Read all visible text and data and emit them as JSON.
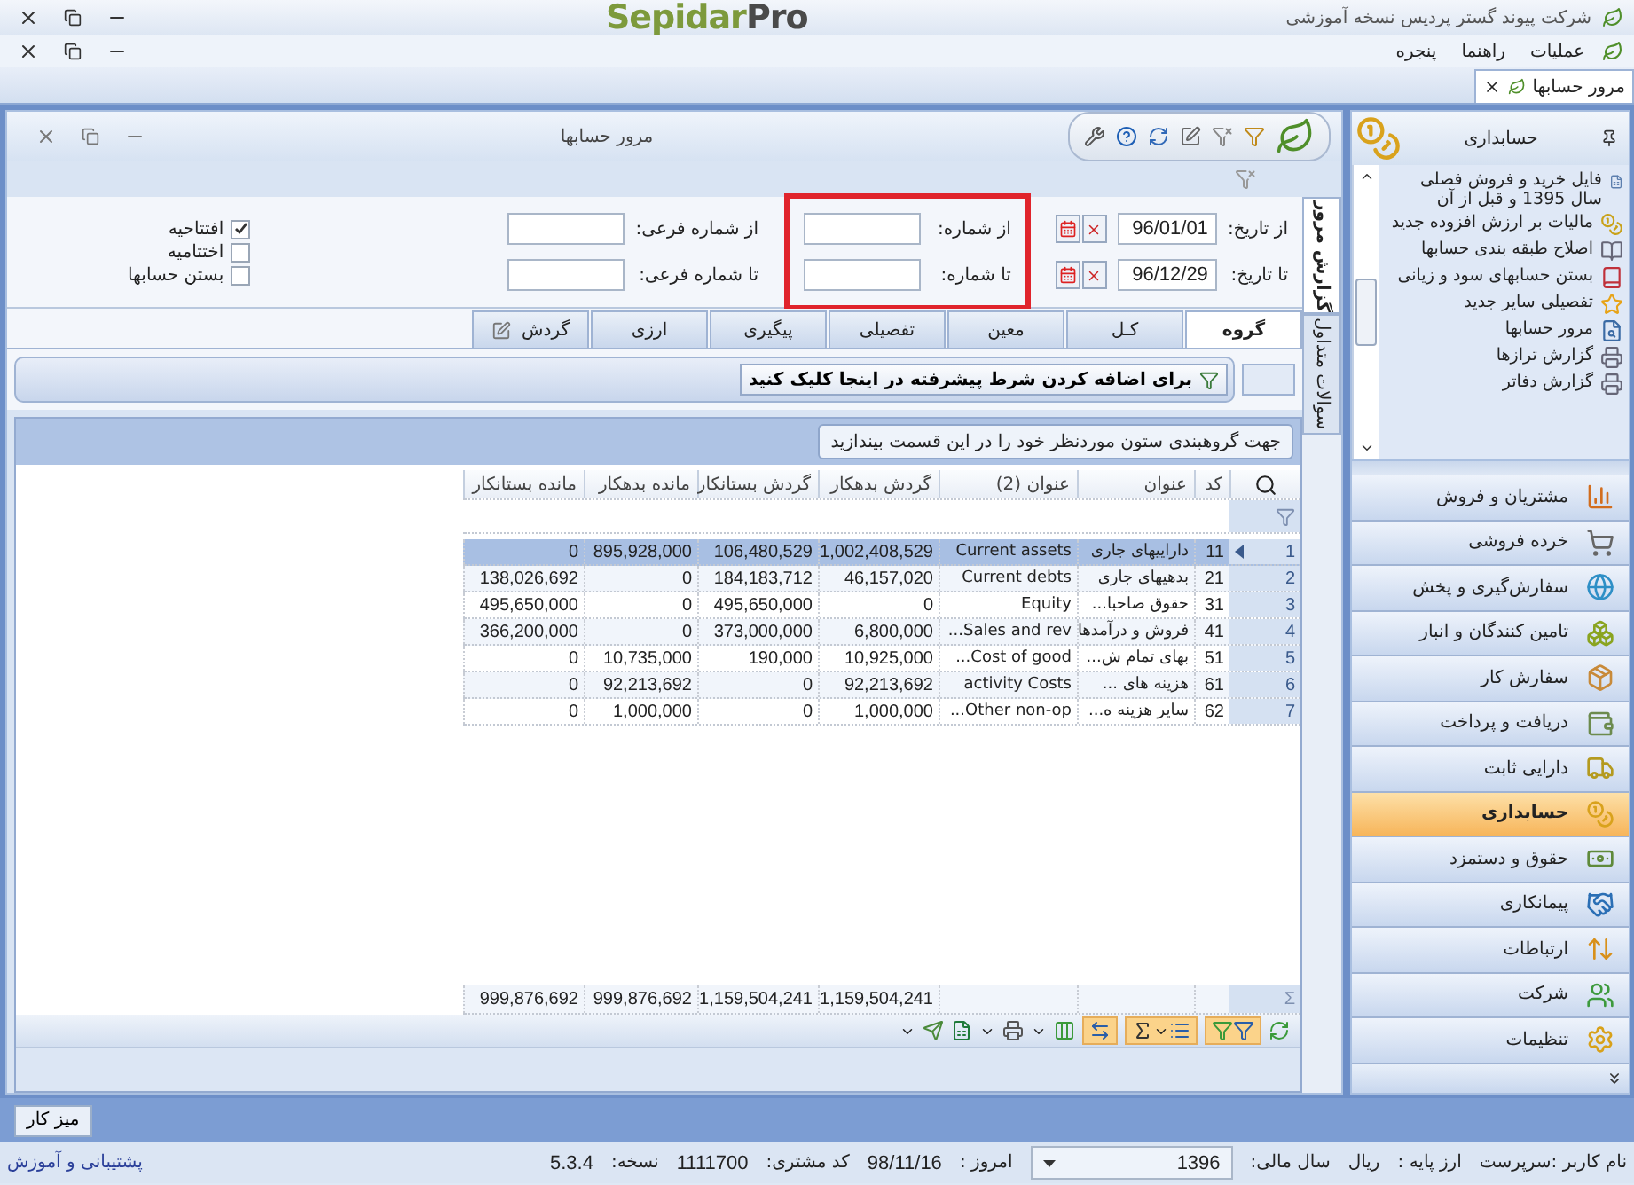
{
  "app_title": {
    "company": "شرکت پیوند گستر پردیس نسخه آموزشی",
    "logo_main": "Sepidar",
    "logo_suffix": "Pro"
  },
  "menu": [
    {
      "label": "عملیات"
    },
    {
      "label": "راهنما"
    },
    {
      "label": "پنجره"
    }
  ],
  "doc_tabs": [
    {
      "label": "مرور حسابها",
      "selected": true
    }
  ],
  "report": {
    "title": "مرور حسابها",
    "side_tabs": [
      {
        "label": "گزارش مرور",
        "selected": true
      },
      {
        "label": "سوالات متداول",
        "selected": false
      }
    ],
    "dates": [
      {
        "label": "از تاریخ:",
        "value": "96/01/01"
      },
      {
        "label": "تا تاریخ:",
        "value": "96/12/29"
      }
    ],
    "numbers": [
      {
        "label": "از شماره:"
      },
      {
        "label": "تا شماره:"
      }
    ],
    "sub_numbers": [
      {
        "label": "از شماره فرعی:"
      },
      {
        "label": "تا شماره فرعی:"
      }
    ],
    "checkboxes": [
      {
        "label": "افتتاحیه",
        "checked": true
      },
      {
        "label": "اختتامیه",
        "checked": false
      },
      {
        "label": "بستن حسابها",
        "checked": false
      }
    ],
    "tabs": [
      {
        "label": "گروه",
        "selected": true
      },
      {
        "label": "کـل",
        "selected": false
      },
      {
        "label": "معین",
        "selected": false
      },
      {
        "label": "تفصیلی",
        "selected": false
      },
      {
        "label": "پیگیری",
        "selected": false
      },
      {
        "label": "ارزی",
        "selected": false
      },
      {
        "label": "گردش",
        "selected": false
      }
    ],
    "advanced_filter": "برای اضافه کردن شرط پیشرفته در اینجا کلیک کنید",
    "group_hint": "جهت گروهبندی ستون موردنظر خود را در این قسمت بیندازید",
    "table": {
      "columns": [
        "کد",
        "عنوان",
        "عنوان (2)",
        "گردش بدهکار",
        "گردش بستانکار",
        "مانده بدهکار",
        "مانده بستانکار"
      ],
      "rows": [
        {
          "number": "1",
          "selected": true,
          "cells": [
            "11",
            "داراییهای جاری",
            "Current assets",
            "1,002,408,529",
            "106,480,529",
            "895,928,000",
            "0"
          ]
        },
        {
          "number": "2",
          "selected": false,
          "cells": [
            "21",
            "بدهیهای جاری",
            "Current debts",
            "46,157,020",
            "184,183,712",
            "0",
            "138,026,692"
          ]
        },
        {
          "number": "3",
          "selected": false,
          "cells": [
            "31",
            "حقوق صاحبا...",
            "Equity",
            "0",
            "495,650,000",
            "0",
            "495,650,000"
          ]
        },
        {
          "number": "4",
          "selected": false,
          "cells": [
            "41",
            "فروش و درآمدها",
            "Sales and rev...",
            "6,800,000",
            "373,000,000",
            "0",
            "366,200,000"
          ]
        },
        {
          "number": "5",
          "selected": false,
          "cells": [
            "51",
            "بهای تمام ش...",
            "Cost of good...",
            "10,925,000",
            "190,000",
            "10,735,000",
            "0"
          ]
        },
        {
          "number": "6",
          "selected": false,
          "cells": [
            "61",
            "هزینه های ...",
            "activity Costs",
            "92,213,692",
            "0",
            "92,213,692",
            "0"
          ]
        },
        {
          "number": "7",
          "selected": false,
          "cells": [
            "62",
            "سایر هزینه ه...",
            "Other non-op...",
            "1,000,000",
            "0",
            "1,000,000",
            "0"
          ]
        }
      ],
      "footer_symbol": "Σ",
      "totals": [
        "1,159,504,241",
        "1,159,504,241",
        "999,876,692",
        "999,876,692"
      ]
    }
  },
  "sidebar": {
    "header": "حسابداری",
    "items": [
      {
        "label": "فایل خرید و فروش فصلی سال 1395 و قبل از آن"
      },
      {
        "label": "مالیات بر ارزش افزوده جدید"
      },
      {
        "label": "اصلاح طبقه بندی حسابها"
      },
      {
        "label": "بستن حسابهای سود و زیانی"
      },
      {
        "label": "تفصیلی سایر جدید"
      },
      {
        "label": "مرور حسابها"
      },
      {
        "label": "گزارش ترازها"
      },
      {
        "label": "گزارش دفاتر"
      }
    ],
    "modules": [
      {
        "label": "مشتریان و فروش",
        "selected": false
      },
      {
        "label": "خرده فروشی",
        "selected": false
      },
      {
        "label": "سفارش‌گیری و پخش",
        "selected": false
      },
      {
        "label": "تامین کنندگان و انبار",
        "selected": false
      },
      {
        "label": "سفارش کار",
        "selected": false
      },
      {
        "label": "دریافت و پرداخت",
        "selected": false
      },
      {
        "label": "دارایی ثابت",
        "selected": false
      },
      {
        "label": "حسابداری",
        "selected": true
      },
      {
        "label": "حقوق و دستمزد",
        "selected": false
      },
      {
        "label": "پیمانکاری",
        "selected": false
      },
      {
        "label": "ارتباطات",
        "selected": false
      },
      {
        "label": "شرکت",
        "selected": false
      },
      {
        "label": "تنظیمات",
        "selected": false
      }
    ]
  },
  "taskbar": {
    "button": "میز کار"
  },
  "status": {
    "user": "نام کاربر :سرپرست",
    "currency_label": "ارز پایه :",
    "currency": "ریال",
    "year_label": "سال مالی:",
    "year": "1396",
    "today_label": "امروز :",
    "today": "98/11/16",
    "customer_label": "کد مشتری:",
    "customer": "1111700",
    "version_label": "نسخه:",
    "version": "5.3.4",
    "support": "پشتیبانی و آموزش"
  }
}
